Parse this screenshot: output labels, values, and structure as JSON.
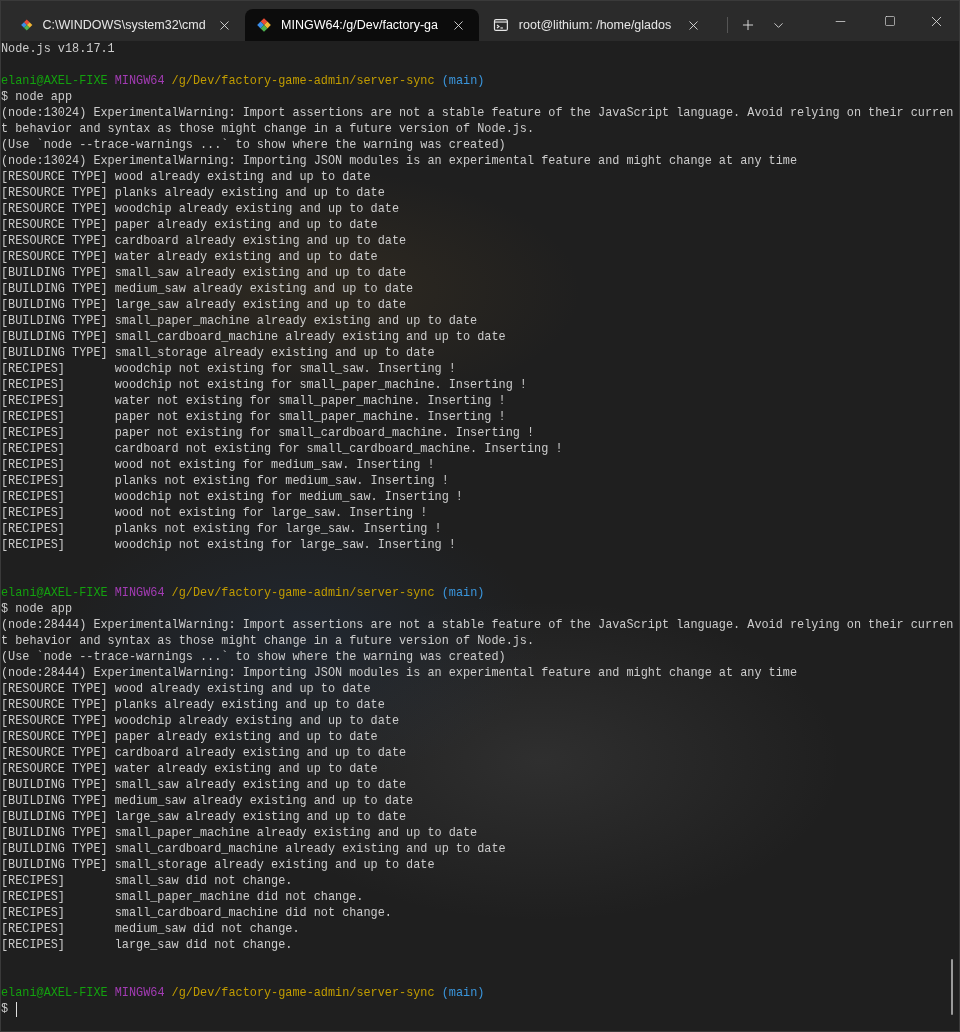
{
  "tabs": [
    {
      "title": "C:\\WINDOWS\\system32\\cmd",
      "selected": false
    },
    {
      "title": "MINGW64:/g/Dev/factory-ga",
      "selected": true
    },
    {
      "title": "root@lithium: /home/glados",
      "selected": false
    }
  ],
  "terminal": {
    "lines": [
      {
        "kind": "output",
        "text": "Node.js v18.17.1"
      },
      {
        "kind": "blank"
      },
      {
        "kind": "prompt",
        "user": "elani@AXEL-FIXE",
        "shell": "MINGW64",
        "path": "/g/Dev/factory-game-admin/server-sync",
        "branch": "(main)"
      },
      {
        "kind": "command",
        "symbol": "$",
        "text": "node app"
      },
      {
        "kind": "output",
        "text": "(node:13024) ExperimentalWarning: Import assertions are not a stable feature of the JavaScript language. Avoid relying on their curren"
      },
      {
        "kind": "output",
        "text": "t behavior and syntax as those might change in a future version of Node.js."
      },
      {
        "kind": "output",
        "text": "(Use `node --trace-warnings ...` to show where the warning was created)"
      },
      {
        "kind": "output",
        "text": "(node:13024) ExperimentalWarning: Importing JSON modules is an experimental feature and might change at any time"
      },
      {
        "kind": "output",
        "text": "[RESOURCE TYPE] wood already existing and up to date"
      },
      {
        "kind": "output",
        "text": "[RESOURCE TYPE] planks already existing and up to date"
      },
      {
        "kind": "output",
        "text": "[RESOURCE TYPE] woodchip already existing and up to date"
      },
      {
        "kind": "output",
        "text": "[RESOURCE TYPE] paper already existing and up to date"
      },
      {
        "kind": "output",
        "text": "[RESOURCE TYPE] cardboard already existing and up to date"
      },
      {
        "kind": "output",
        "text": "[RESOURCE TYPE] water already existing and up to date"
      },
      {
        "kind": "output",
        "text": "[BUILDING TYPE] small_saw already existing and up to date"
      },
      {
        "kind": "output",
        "text": "[BUILDING TYPE] medium_saw already existing and up to date"
      },
      {
        "kind": "output",
        "text": "[BUILDING TYPE] large_saw already existing and up to date"
      },
      {
        "kind": "output",
        "text": "[BUILDING TYPE] small_paper_machine already existing and up to date"
      },
      {
        "kind": "output",
        "text": "[BUILDING TYPE] small_cardboard_machine already existing and up to date"
      },
      {
        "kind": "output",
        "text": "[BUILDING TYPE] small_storage already existing and up to date"
      },
      {
        "kind": "output",
        "text": "[RECIPES]       woodchip not existing for small_saw. Inserting !"
      },
      {
        "kind": "output",
        "text": "[RECIPES]       woodchip not existing for small_paper_machine. Inserting !"
      },
      {
        "kind": "output",
        "text": "[RECIPES]       water not existing for small_paper_machine. Inserting !"
      },
      {
        "kind": "output",
        "text": "[RECIPES]       paper not existing for small_paper_machine. Inserting !"
      },
      {
        "kind": "output",
        "text": "[RECIPES]       paper not existing for small_cardboard_machine. Inserting !"
      },
      {
        "kind": "output",
        "text": "[RECIPES]       cardboard not existing for small_cardboard_machine. Inserting !"
      },
      {
        "kind": "output",
        "text": "[RECIPES]       wood not existing for medium_saw. Inserting !"
      },
      {
        "kind": "output",
        "text": "[RECIPES]       planks not existing for medium_saw. Inserting !"
      },
      {
        "kind": "output",
        "text": "[RECIPES]       woodchip not existing for medium_saw. Inserting !"
      },
      {
        "kind": "output",
        "text": "[RECIPES]       wood not existing for large_saw. Inserting !"
      },
      {
        "kind": "output",
        "text": "[RECIPES]       planks not existing for large_saw. Inserting !"
      },
      {
        "kind": "output",
        "text": "[RECIPES]       woodchip not existing for large_saw. Inserting !"
      },
      {
        "kind": "blank"
      },
      {
        "kind": "blank"
      },
      {
        "kind": "prompt",
        "user": "elani@AXEL-FIXE",
        "shell": "MINGW64",
        "path": "/g/Dev/factory-game-admin/server-sync",
        "branch": "(main)"
      },
      {
        "kind": "command",
        "symbol": "$",
        "text": "node app"
      },
      {
        "kind": "output",
        "text": "(node:28444) ExperimentalWarning: Import assertions are not a stable feature of the JavaScript language. Avoid relying on their curren"
      },
      {
        "kind": "output",
        "text": "t behavior and syntax as those might change in a future version of Node.js."
      },
      {
        "kind": "output",
        "text": "(Use `node --trace-warnings ...` to show where the warning was created)"
      },
      {
        "kind": "output",
        "text": "(node:28444) ExperimentalWarning: Importing JSON modules is an experimental feature and might change at any time"
      },
      {
        "kind": "output",
        "text": "[RESOURCE TYPE] wood already existing and up to date"
      },
      {
        "kind": "output",
        "text": "[RESOURCE TYPE] planks already existing and up to date"
      },
      {
        "kind": "output",
        "text": "[RESOURCE TYPE] woodchip already existing and up to date"
      },
      {
        "kind": "output",
        "text": "[RESOURCE TYPE] paper already existing and up to date"
      },
      {
        "kind": "output",
        "text": "[RESOURCE TYPE] cardboard already existing and up to date"
      },
      {
        "kind": "output",
        "text": "[RESOURCE TYPE] water already existing and up to date"
      },
      {
        "kind": "output",
        "text": "[BUILDING TYPE] small_saw already existing and up to date"
      },
      {
        "kind": "output",
        "text": "[BUILDING TYPE] medium_saw already existing and up to date"
      },
      {
        "kind": "output",
        "text": "[BUILDING TYPE] large_saw already existing and up to date"
      },
      {
        "kind": "output",
        "text": "[BUILDING TYPE] small_paper_machine already existing and up to date"
      },
      {
        "kind": "output",
        "text": "[BUILDING TYPE] small_cardboard_machine already existing and up to date"
      },
      {
        "kind": "output",
        "text": "[BUILDING TYPE] small_storage already existing and up to date"
      },
      {
        "kind": "output",
        "text": "[RECIPES]       small_saw did not change."
      },
      {
        "kind": "output",
        "text": "[RECIPES]       small_paper_machine did not change."
      },
      {
        "kind": "output",
        "text": "[RECIPES]       small_cardboard_machine did not change."
      },
      {
        "kind": "output",
        "text": "[RECIPES]       medium_saw did not change."
      },
      {
        "kind": "output",
        "text": "[RECIPES]       large_saw did not change."
      },
      {
        "kind": "blank"
      },
      {
        "kind": "blank"
      },
      {
        "kind": "prompt",
        "user": "elani@AXEL-FIXE",
        "shell": "MINGW64",
        "path": "/g/Dev/factory-game-admin/server-sync",
        "branch": "(main)"
      },
      {
        "kind": "input",
        "symbol": "$"
      }
    ]
  }
}
